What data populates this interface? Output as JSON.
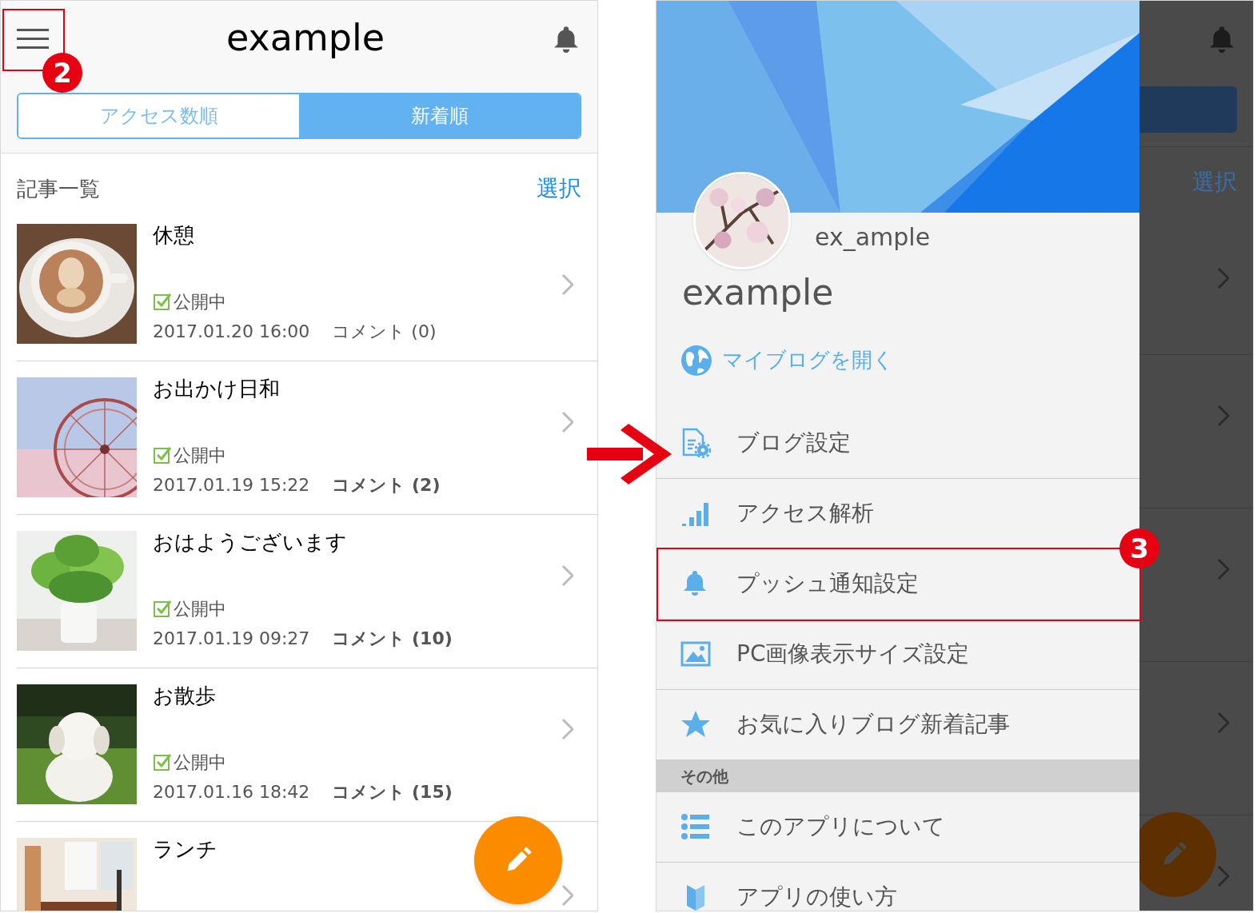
{
  "left_screen": {
    "header": {
      "title": "example"
    },
    "step_badge": "2",
    "tabs": [
      {
        "label": "アクセス数順",
        "selected": false
      },
      {
        "label": "新着順",
        "selected": true
      }
    ],
    "list_title": "記事一覧",
    "select_link": "選択",
    "posts": [
      {
        "title": "休憩",
        "status": "公開中",
        "date": "2017.01.20 16:00",
        "comments": "コメント (0)",
        "has_comments": false
      },
      {
        "title": "お出かけ日和",
        "status": "公開中",
        "date": "2017.01.19 15:22",
        "comments": "コメント (2)",
        "has_comments": true
      },
      {
        "title": "おはようございます",
        "status": "公開中",
        "date": "2017.01.19 09:27",
        "comments": "コメント (10)",
        "has_comments": true
      },
      {
        "title": "お散歩",
        "status": "公開中",
        "date": "2017.01.16 18:42",
        "comments": "コメント (15)",
        "has_comments": true
      },
      {
        "title": "ランチ"
      }
    ]
  },
  "right_screen": {
    "drawer": {
      "username": "ex_ample",
      "blog_name": "example",
      "open_blog_link": "マイブログを開く",
      "menu": [
        {
          "label": "ブログ設定",
          "annotated": false
        },
        {
          "label": "アクセス解析",
          "annotated": false
        },
        {
          "label": "プッシュ通知設定",
          "annotated": true
        },
        {
          "label": "PC画像表示サイズ設定",
          "annotated": false
        },
        {
          "label": "お気に入りブログ新着記事",
          "annotated": false
        }
      ],
      "other_section": {
        "title": "その他",
        "items": [
          {
            "label": "このアプリについて",
            "annotated": false
          },
          {
            "label": "アプリの使い方",
            "annotated": false
          }
        ]
      }
    },
    "step_badge": "3",
    "background": {
      "select_link": "選択"
    }
  }
}
